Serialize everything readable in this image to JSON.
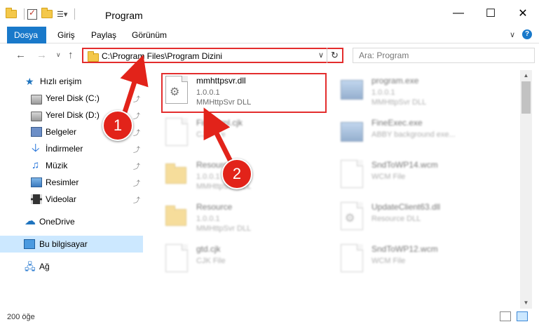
{
  "window": {
    "title": "Program",
    "minimize_glyph": "—",
    "maximize_glyph": "☐",
    "close_glyph": "✕"
  },
  "ribbon": {
    "tabs": [
      {
        "label": "Dosya",
        "active": true
      },
      {
        "label": "Giriş",
        "active": false
      },
      {
        "label": "Paylaş",
        "active": false
      },
      {
        "label": "Görünüm",
        "active": false
      }
    ],
    "expand_glyph": "∨",
    "help_glyph": "?"
  },
  "nav": {
    "back_glyph": "←",
    "forward_glyph": "→",
    "recent_glyph": "∨",
    "up_glyph": "↑",
    "address_path": "C:\\Program Files\\Program Dizini",
    "address_dropdown_glyph": "∨",
    "refresh_glyph": "↻",
    "search_placeholder": "Ara: Program"
  },
  "sidebar": {
    "items": [
      {
        "label": "Hızlı erişim",
        "icon": "star-icon",
        "pinned": false,
        "selected": false
      },
      {
        "label": "Yerel Disk (C:)",
        "icon": "disk-icon",
        "pinned": true,
        "selected": false
      },
      {
        "label": "Yerel Disk (D:)",
        "icon": "disk-icon",
        "pinned": true,
        "selected": false
      },
      {
        "label": "Belgeler",
        "icon": "documents-icon",
        "pinned": true,
        "selected": false
      },
      {
        "label": "İndirmeler",
        "icon": "download-icon",
        "pinned": true,
        "selected": false
      },
      {
        "label": "Müzik",
        "icon": "music-icon",
        "pinned": true,
        "selected": false
      },
      {
        "label": "Resimler",
        "icon": "pictures-icon",
        "pinned": true,
        "selected": false
      },
      {
        "label": "Videolar",
        "icon": "videos-icon",
        "pinned": true,
        "selected": false
      },
      {
        "label": "OneDrive",
        "icon": "cloud-icon",
        "pinned": false,
        "selected": false
      },
      {
        "label": "Bu bilgisayar",
        "icon": "computer-icon",
        "pinned": false,
        "selected": true
      },
      {
        "label": "Ağ",
        "icon": "network-icon",
        "pinned": false,
        "selected": false
      }
    ],
    "pin_glyph": "📌"
  },
  "files": [
    {
      "name": "mmhttpsvr.dll",
      "line2": "1.0.0.1",
      "line3": "MMHttpSvr DLL",
      "icon": "dll-icon",
      "highlighted": true
    },
    {
      "name": "program.exe",
      "line2": "1.0.0.1",
      "line3": "MMHttpSvr DLL",
      "icon": "exe-icon",
      "highlighted": false
    },
    {
      "name": "FineHtml.cjk",
      "line2": "CJK File",
      "line3": "",
      "icon": "file-icon",
      "highlighted": false
    },
    {
      "name": "FineExec.exe",
      "line2": "ABBY background exe...",
      "line3": "",
      "icon": "exe-icon",
      "highlighted": false
    },
    {
      "name": "Resource",
      "line2": "1.0.0.1",
      "line3": "MMHttpSvr DLL",
      "icon": "folder-icon",
      "highlighted": false
    },
    {
      "name": "SndToWP14.wcm",
      "line2": "WCM File",
      "line3": "",
      "icon": "file-icon",
      "highlighted": false
    },
    {
      "name": "Resource",
      "line2": "1.0.0.1",
      "line3": "MMHttpSvr DLL",
      "icon": "folder-icon",
      "highlighted": false
    },
    {
      "name": "UpdateClient63.dll",
      "line2": "Resource DLL",
      "line3": "",
      "icon": "dll-icon",
      "highlighted": false
    },
    {
      "name": "gtd.cjk",
      "line2": "CJK File",
      "line3": "",
      "icon": "file-icon",
      "highlighted": false
    },
    {
      "name": "SndToWP12.wcm",
      "line2": "WCM File",
      "line3": "",
      "icon": "file-icon",
      "highlighted": false
    }
  ],
  "gear_glyph": "⚙",
  "status": {
    "item_count": "200 öğe"
  },
  "scroll": {
    "up_glyph": "▲",
    "down_glyph": "▼"
  },
  "annotations": {
    "step1": "1",
    "step2": "2",
    "color": "#e2231a"
  },
  "colors": {
    "accent": "#1979ca",
    "selection": "#cce8ff",
    "highlight_border": "#e32d2d"
  }
}
